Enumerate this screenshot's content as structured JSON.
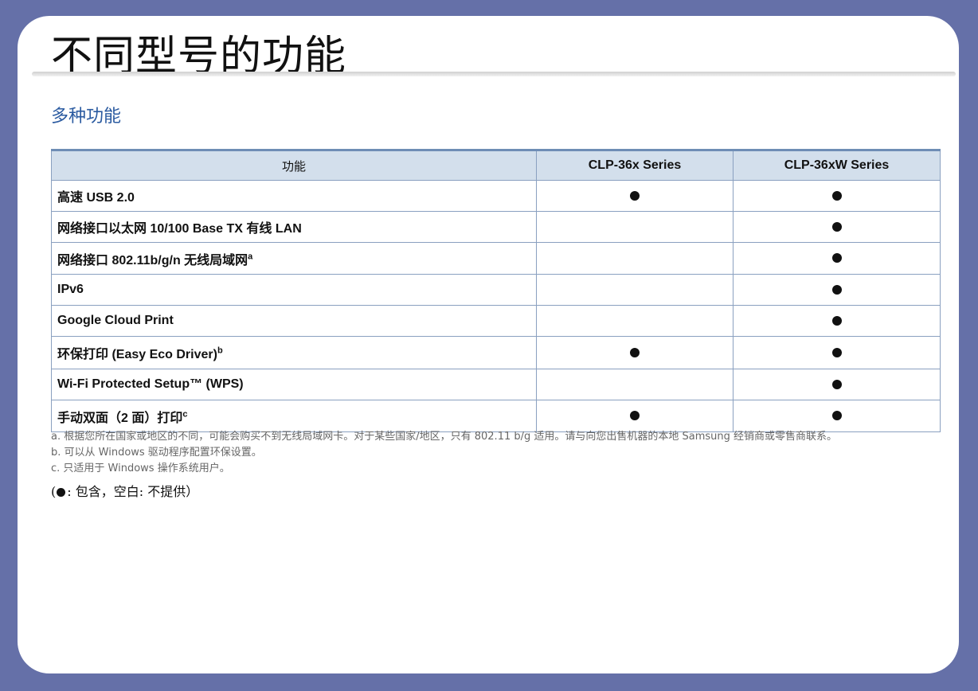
{
  "page_title": "不同型号的功能",
  "section_title": "多种功能",
  "table": {
    "headers": [
      "功能",
      "CLP-36x Series",
      "CLP-36xW Series"
    ],
    "rows": [
      {
        "feature": "高速 USB 2.0",
        "sup": "",
        "clp36x": true,
        "clp36xw": true
      },
      {
        "feature": "网络接口以太网 10/100 Base TX 有线 LAN",
        "sup": "",
        "clp36x": false,
        "clp36xw": true
      },
      {
        "feature": "网络接口 802.11b/g/n 无线局域网",
        "sup": "a",
        "clp36x": false,
        "clp36xw": true
      },
      {
        "feature": "IPv6",
        "sup": "",
        "clp36x": false,
        "clp36xw": true
      },
      {
        "feature": "Google Cloud Print",
        "sup": "",
        "clp36x": false,
        "clp36xw": true
      },
      {
        "feature": "环保打印 (Easy Eco Driver)",
        "sup": "b",
        "clp36x": true,
        "clp36xw": true
      },
      {
        "feature": "Wi-Fi Protected Setup™ (WPS)",
        "sup": "",
        "clp36x": false,
        "clp36xw": true
      },
      {
        "feature": "手动双面（2 面）打印",
        "sup": "c",
        "clp36x": true,
        "clp36xw": true
      }
    ]
  },
  "notes": [
    "a. 根据您所在国家或地区的不同，可能会购买不到无线局域网卡。对于某些国家/地区，只有 802.11 b/g 适用。请与向您出售机器的本地 Samsung 经销商或零售商联系。",
    "b. 可以从 Windows 驱动程序配置环保设置。",
    "c. 只适用于 Windows 操作系统用户。"
  ],
  "legend": {
    "open": "(",
    "text": ": 包含，空白: 不提供）"
  },
  "colors": {
    "frame": "#6570a8",
    "header_bg": "#d3dfec",
    "accent": "#2a5aa0"
  }
}
